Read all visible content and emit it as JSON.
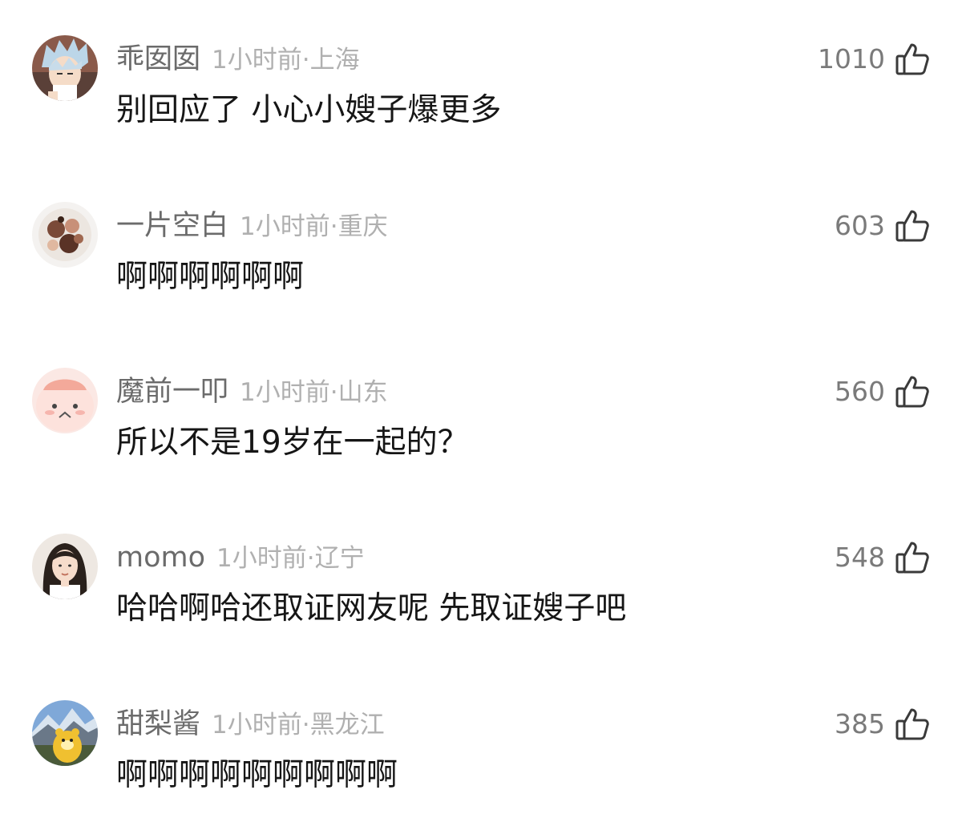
{
  "comments": [
    {
      "username": "乖囡囡",
      "time": "1小时前",
      "location": "上海",
      "text": "别回应了 小心小嫂子爆更多",
      "likes": "1010",
      "avatar": "anime-silver-hair-avatar"
    },
    {
      "username": "一片空白",
      "time": "1小时前",
      "location": "重庆",
      "text": "啊啊啊啊啊啊",
      "likes": "603",
      "avatar": "food-sticker-avatar"
    },
    {
      "username": "魔前一叩",
      "time": "1小时前",
      "location": "山东",
      "text": "所以不是19岁在一起的？",
      "likes": "560",
      "avatar": "pink-blob-avatar"
    },
    {
      "username": "momo",
      "time": "1小时前",
      "location": "辽宁",
      "text": "哈哈啊哈还取证网友呢 先取证嫂子吧",
      "likes": "548",
      "avatar": "woman-portrait-avatar"
    },
    {
      "username": "甜梨酱",
      "time": "1小时前",
      "location": "黑龙江",
      "text": "啊啊啊啊啊啊啊啊啊",
      "likes": "385",
      "avatar": "mountain-bear-avatar"
    }
  ],
  "separator": "·",
  "colors": {
    "username": "#6b6b6b",
    "meta": "#b0b0b0",
    "text": "#161616",
    "likes": "#7a7a7a"
  },
  "icons": {
    "like": "thumbs-up-icon"
  }
}
